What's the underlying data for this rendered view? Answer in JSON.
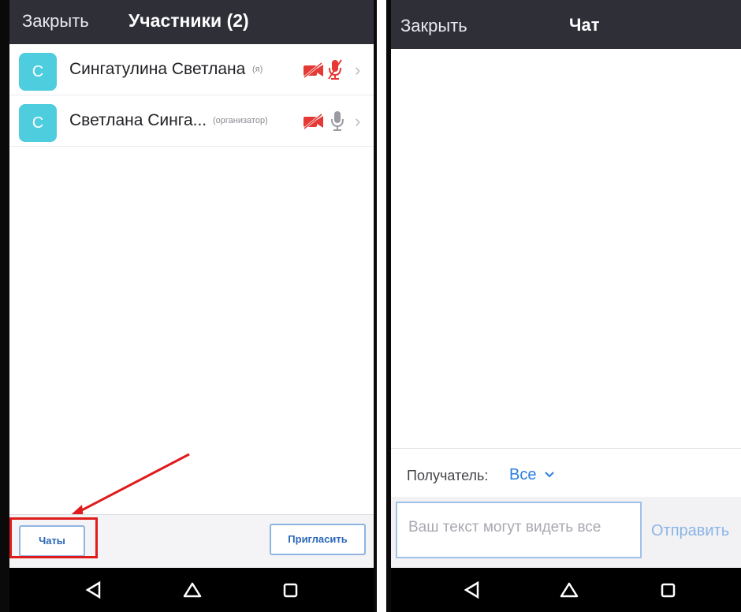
{
  "left_panel": {
    "header": {
      "close_label": "Закрыть",
      "title": "Участники (2)"
    },
    "participants": [
      {
        "initial": "С",
        "name": "Сингатулина Светлана",
        "role": "(я)",
        "video": "video-off-icon",
        "audio": "mic-off-icon"
      },
      {
        "initial": "С",
        "name": "Светлана Синга...",
        "role": "(организатор)",
        "video": "video-off-icon",
        "audio": "mic-icon"
      }
    ],
    "footer": {
      "chats_label": "Чаты",
      "invite_label": "Пригласить"
    }
  },
  "right_panel": {
    "header": {
      "close_label": "Закрыть",
      "title": "Чат"
    },
    "recipient": {
      "label": "Получатель:",
      "value": "Все"
    },
    "input": {
      "placeholder": "Ваш текст могут видеть все"
    },
    "send_label": "Отправить"
  },
  "colors": {
    "header_bg": "#2f2f38",
    "avatar": "#4ecdde",
    "muted_red": "#e53935",
    "link_blue": "#2a7de1",
    "highlight_red": "#e01b1b"
  }
}
